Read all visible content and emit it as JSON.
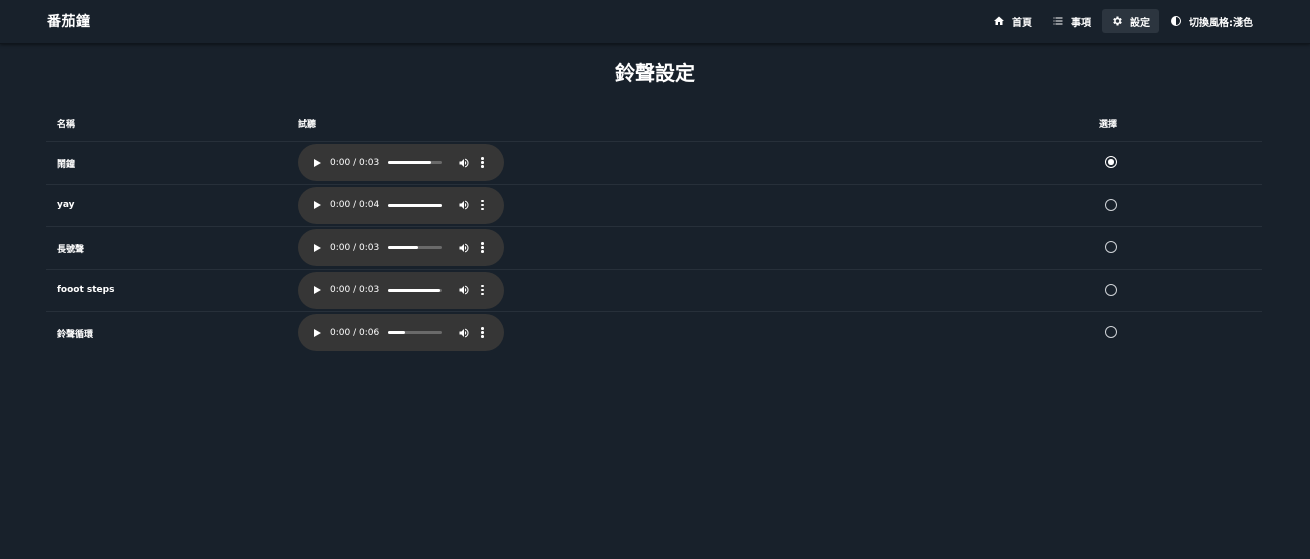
{
  "app": {
    "title": "番茄鐘"
  },
  "nav": {
    "items": [
      {
        "label": "首頁",
        "icon": "home-icon"
      },
      {
        "label": "事項",
        "icon": "list-icon"
      },
      {
        "label": "設定",
        "icon": "gear-icon",
        "active": true
      },
      {
        "label": "切換風格:淺色",
        "icon": "contrast-icon"
      }
    ]
  },
  "page": {
    "title": "鈴聲設定"
  },
  "table": {
    "headers": {
      "name": "名稱",
      "preview": "試聽",
      "select": "選擇"
    },
    "rows": [
      {
        "name": "鬧鐘",
        "time": "0:00 / 0:03",
        "progress": 0.8,
        "selected": true
      },
      {
        "name": "yay",
        "time": "0:00 / 0:04",
        "progress": 1.0,
        "selected": false
      },
      {
        "name": "長號聲",
        "time": "0:00 / 0:03",
        "progress": 0.55,
        "selected": false
      },
      {
        "name": "fooot steps",
        "time": "0:00 / 0:03",
        "progress": 0.97,
        "selected": false
      },
      {
        "name": "鈴聲循環",
        "time": "0:00 / 0:06",
        "progress": 0.32,
        "selected": false
      }
    ]
  },
  "colors": {
    "background": "#18212b",
    "audio_player": "#363636",
    "active_nav": "#2c353f"
  }
}
